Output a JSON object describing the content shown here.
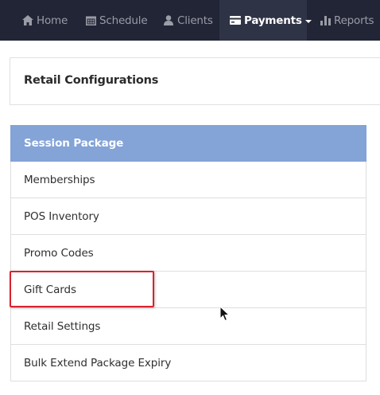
{
  "nav": {
    "home": "Home",
    "schedule": "Schedule",
    "clients": "Clients",
    "payments": "Payments",
    "reports": "Reports"
  },
  "config": {
    "title": "Retail Configurations"
  },
  "menu": {
    "items": [
      {
        "label": "Session Package",
        "active": true
      },
      {
        "label": "Memberships"
      },
      {
        "label": "POS Inventory"
      },
      {
        "label": "Promo Codes"
      },
      {
        "label": "Gift Cards"
      },
      {
        "label": "Retail Settings"
      },
      {
        "label": "Bulk Extend Package Expiry"
      }
    ]
  },
  "colors": {
    "navbar_bg": "#222536",
    "nav_active_bg": "#2e3346",
    "menu_active_bg": "#84a3d6",
    "highlight": "#d9232e"
  }
}
